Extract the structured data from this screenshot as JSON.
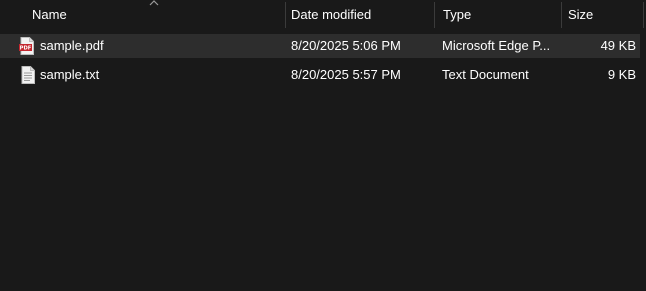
{
  "columns": {
    "name": "Name",
    "date_modified": "Date modified",
    "type": "Type",
    "size": "Size"
  },
  "files": [
    {
      "icon": "pdf-file-icon",
      "name": "sample.pdf",
      "date_modified": "8/20/2025 5:06 PM",
      "type": "Microsoft Edge P...",
      "size": "49 KB",
      "selected": true
    },
    {
      "icon": "text-file-icon",
      "name": "sample.txt",
      "date_modified": "8/20/2025 5:57 PM",
      "type": "Text Document",
      "size": "9 KB",
      "selected": false
    }
  ],
  "colors": {
    "background": "#191919",
    "selected_row": "#2d2d2d",
    "text": "#ffffff",
    "separator": "#3b3b3b",
    "pdf_icon_red": "#c4262e"
  }
}
